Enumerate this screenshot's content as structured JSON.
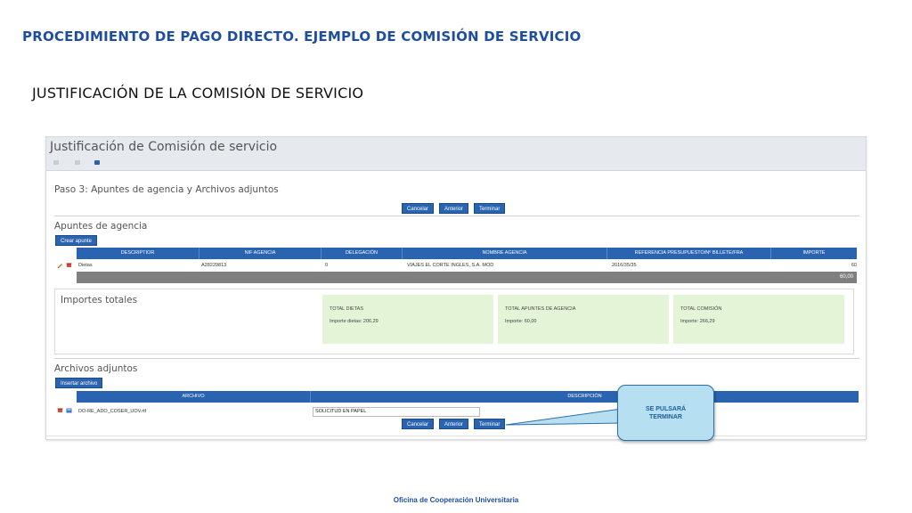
{
  "slide": {
    "title": "PROCEDIMIENTO DE PAGO DIRECTO. EJEMPLO DE COMISIÓN DE SERVICIO",
    "subtitle": "JUSTIFICACIÓN DE LA COMISIÓN DE SERVICIO",
    "footer": "Oficina de Cooperación Universitaria"
  },
  "app": {
    "title": "Justificación de Comisión de servicio",
    "step_title": "Paso 3: Apuntes de agencia y Archivos adjuntos",
    "nav_buttons": {
      "cancel": "Cancelar",
      "previous": "Anterior",
      "finish": "Terminar"
    }
  },
  "apuntes": {
    "section_title": "Apuntes de agencia",
    "create_button": "Crear apunte",
    "columns": [
      "DESCRIPTIOR",
      "NIF AGENCIA",
      "DELEGACIÓN",
      "NOMBRE AGENCIA",
      "REFERENCIA PRESUPUESTO/Nº BILLETE/FRA",
      "IMPORTE"
    ],
    "rows": [
      {
        "descriptor": "Dietas",
        "nif": "A28229813",
        "delegacion": "0",
        "nombre": "VIAJES EL CORTE INGLES, S.A. MOD",
        "referencia": "2016/35/35",
        "importe": "60"
      }
    ],
    "total": "60,00"
  },
  "importes": {
    "section_title": "Importes totales",
    "cards": [
      {
        "title": "TOTAL DIETAS",
        "label": "Importe dietas:",
        "value": "206,29"
      },
      {
        "title": "TOTAL APUNTES DE AGENCIA",
        "label": "Importe:",
        "value": "60,00"
      },
      {
        "title": "TOTAL COMISIÓN",
        "label": "Importe:",
        "value": "266,29"
      }
    ]
  },
  "archivos": {
    "section_title": "Archivos adjuntos",
    "insert_button": "Insertar archivo",
    "columns": [
      "ARCHIVO",
      "DESCRIPCIÓN"
    ],
    "rows": [
      {
        "archivo": "DO-RE_ADO_COSER_UOV.rtf",
        "descripcion": "SOLICITUD EN PAPEL"
      }
    ]
  },
  "callout": {
    "line1": "SE PULSARÁ",
    "line2": "TERMINAR"
  },
  "colors": {
    "accent": "#2a64b0",
    "slide_title": "#1f4e9c",
    "card_bg": "#e4f4d6",
    "callout_bg": "#b7dff2",
    "total_bar": "#7f7f7f"
  },
  "icons": {
    "edit": "pencil-icon",
    "delete": "trash-icon",
    "file": "file-icon"
  }
}
